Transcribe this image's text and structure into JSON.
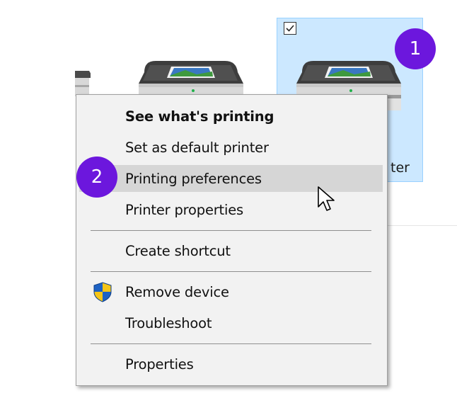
{
  "selected_printer": {
    "label_fragment": "ter",
    "checkbox_checked": true
  },
  "badges": {
    "step1": "1",
    "step2": "2",
    "color": "#6c17dd"
  },
  "context_menu": {
    "items": [
      {
        "label": "See what's printing",
        "bold": true
      },
      {
        "label": "Set as default printer"
      },
      {
        "label": "Printing preferences",
        "highlighted": true
      },
      {
        "label": "Printer properties"
      },
      {
        "label": "Create shortcut"
      },
      {
        "label": "Remove device",
        "icon": "uac-shield-icon"
      },
      {
        "label": "Troubleshoot"
      },
      {
        "label": "Properties"
      }
    ]
  },
  "colors": {
    "selection_bg": "#cce8ff",
    "selection_border": "#99d1ff",
    "menu_bg": "#f2f2f2",
    "menu_hover": "#d6d6d6"
  }
}
